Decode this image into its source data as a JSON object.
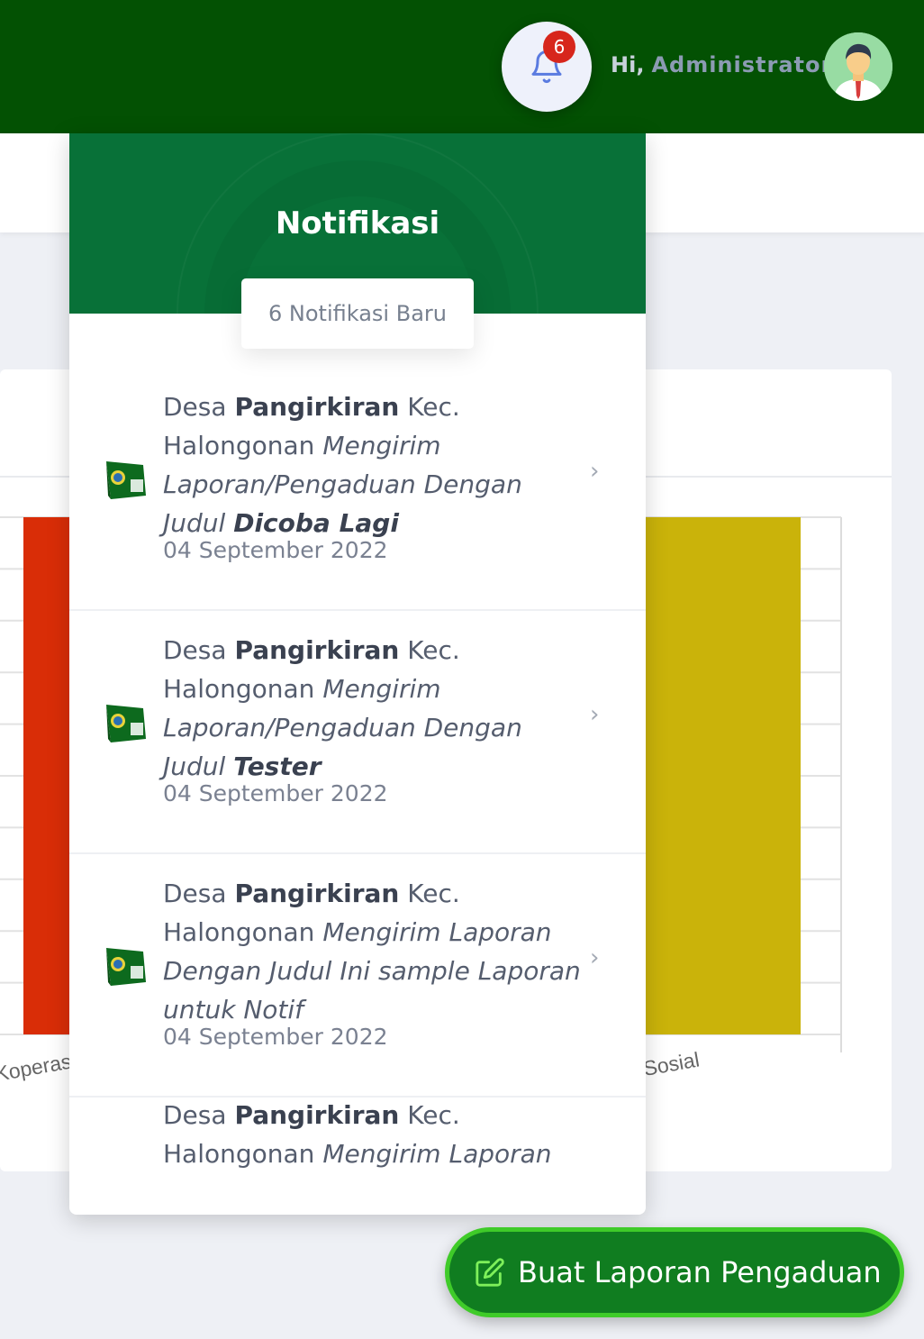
{
  "header": {
    "notification_badge": "6",
    "greeting": "Hi,",
    "user_name": "Administrator"
  },
  "notifications": {
    "title": "Notifikasi",
    "count_label": "6 Notifikasi Baru",
    "items": [
      {
        "prefix": "Desa ",
        "village": "Pangirkiran",
        "mid": " Kec. Halongonan ",
        "action": "Mengirim Laporan/Pengaduan Dengan Judul ",
        "subject": "Dicoba Lagi",
        "date": "04 September 2022"
      },
      {
        "prefix": "Desa ",
        "village": "Pangirkiran",
        "mid": " Kec. Halongonan ",
        "action": "Mengirim Laporan/Pengaduan Dengan Judul ",
        "subject": "Tester",
        "date": "04 September 2022"
      },
      {
        "prefix": "Desa ",
        "village": "Pangirkiran",
        "mid": " Kec. Halongonan ",
        "action": "Mengirim Laporan Dengan Judul Ini sample Laporan untuk Notif",
        "subject": "",
        "date": "04 September 2022"
      },
      {
        "prefix": "Desa ",
        "village": "Pangirkiran",
        "mid": " Kec. Halongonan ",
        "action": "Mengirim Laporan",
        "subject": "",
        "date": ""
      }
    ]
  },
  "chart_data": {
    "type": "bar",
    "categories": [
      "Koperas",
      "Sosial"
    ],
    "colors": [
      "#d92d07",
      "#cab30a"
    ],
    "title": "",
    "xlabel": "",
    "ylabel": ""
  },
  "fab": {
    "label": "Buat Laporan Pengaduan",
    "icon": "edit-icon"
  }
}
